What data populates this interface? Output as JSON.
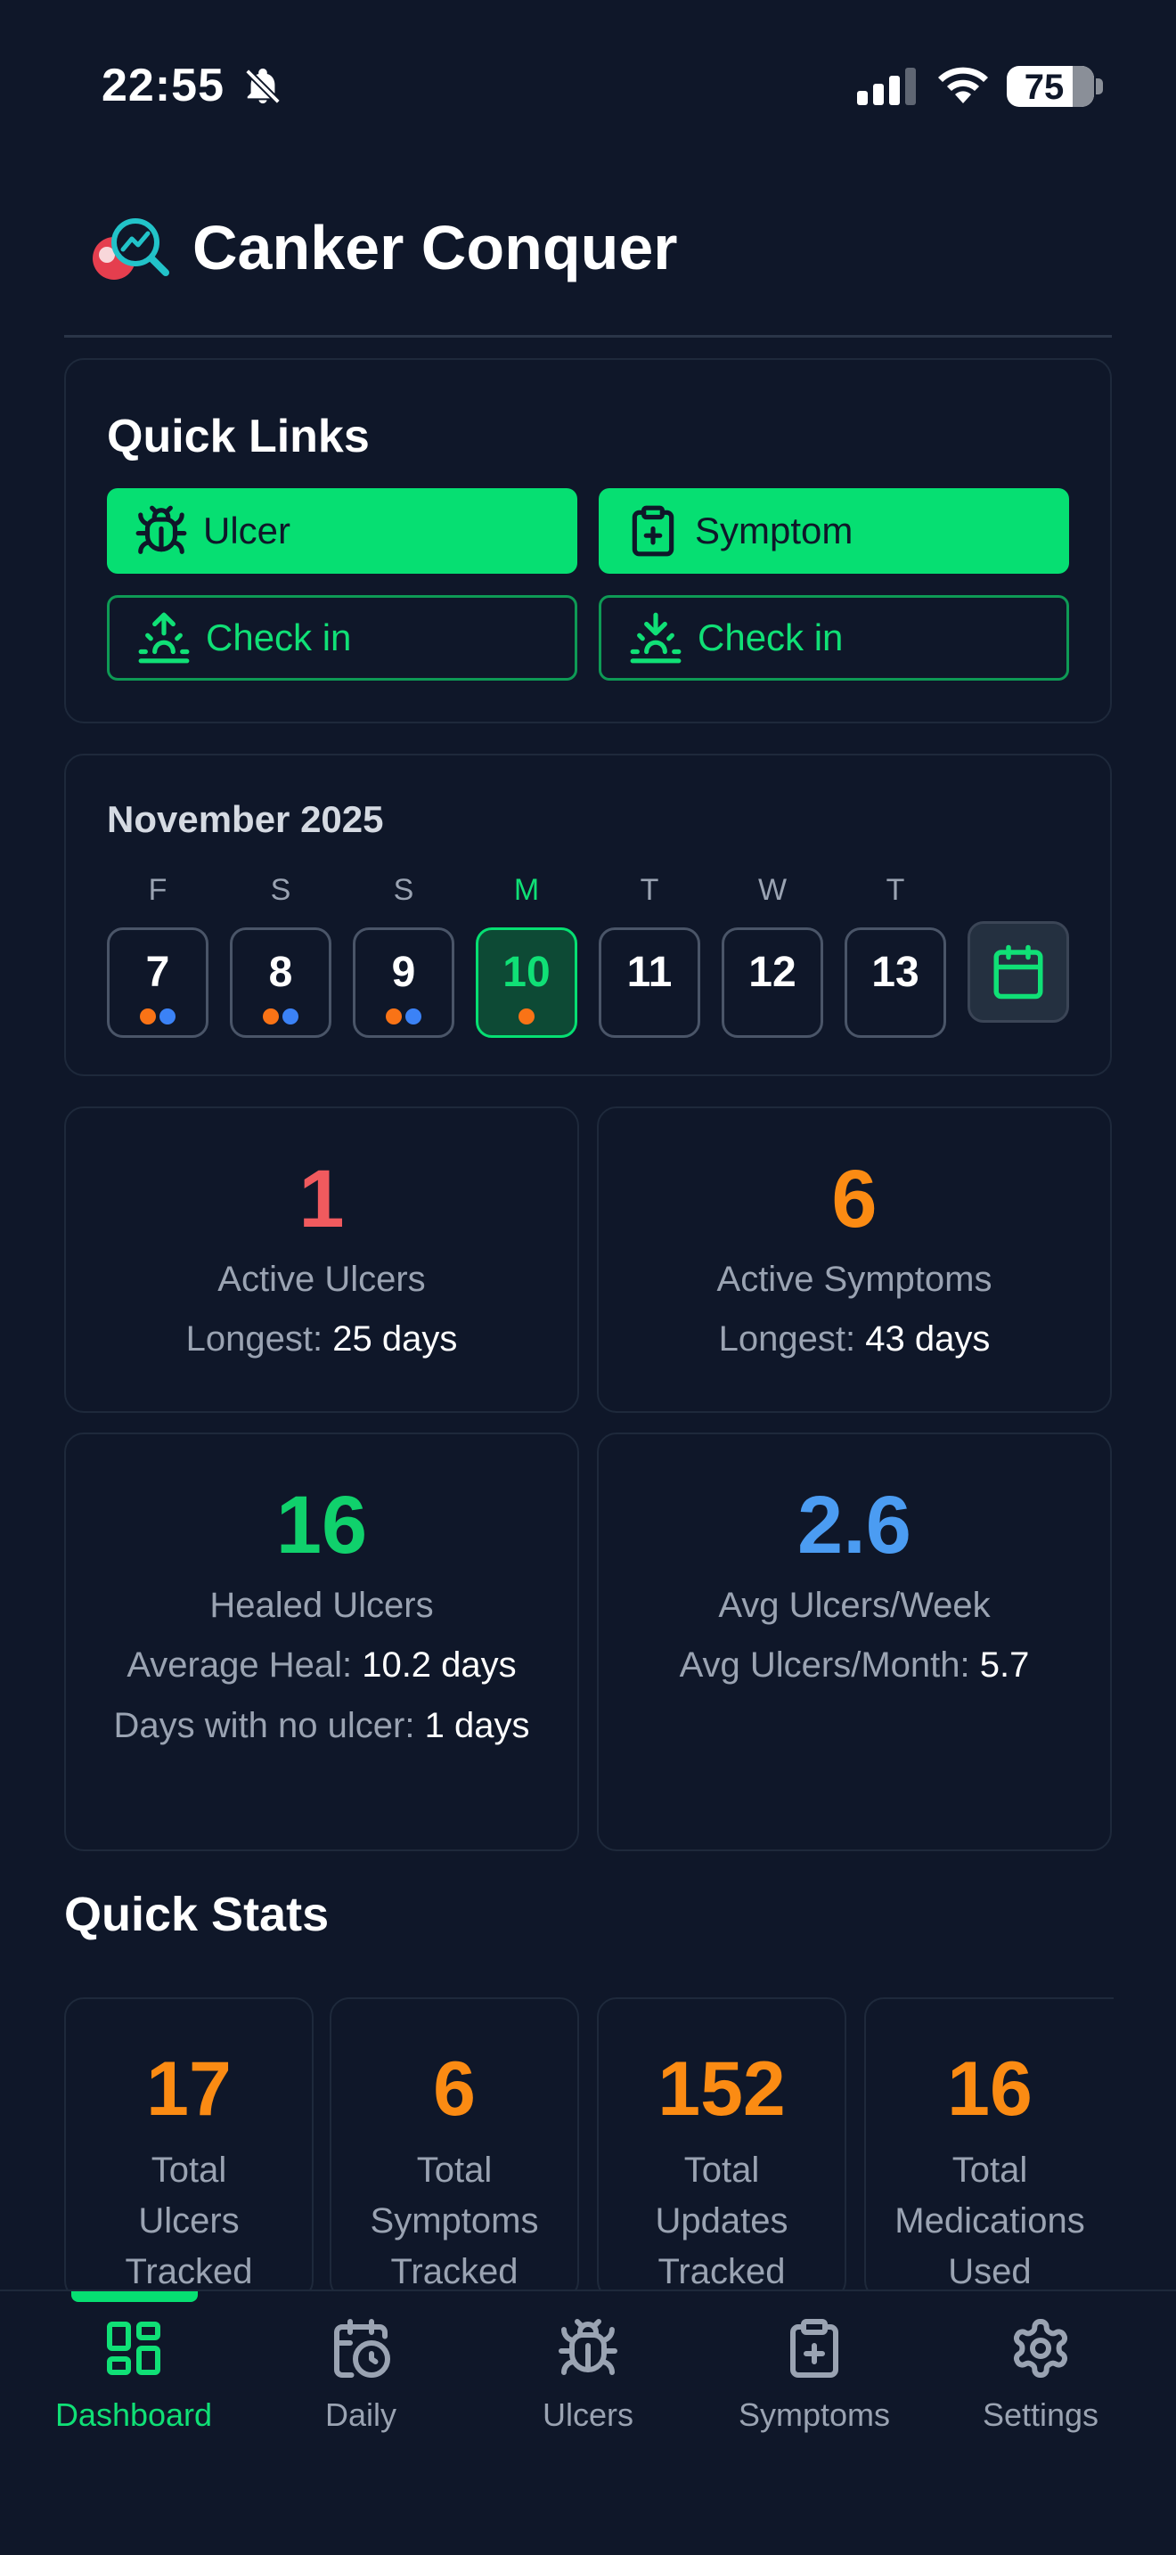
{
  "status_bar": {
    "time": "22:55",
    "battery": "75"
  },
  "header": {
    "title": "Canker Conquer"
  },
  "quick_links": {
    "title": "Quick Links",
    "buttons": [
      {
        "label": "Ulcer",
        "icon": "bug-icon",
        "style": "filled"
      },
      {
        "label": "Symptom",
        "icon": "clipboard-plus-icon",
        "style": "filled"
      },
      {
        "label": "Check in",
        "icon": "sunrise-icon",
        "style": "outline"
      },
      {
        "label": "Check in",
        "icon": "sunset-icon",
        "style": "outline"
      }
    ]
  },
  "calendar": {
    "month": "November 2025",
    "days": [
      {
        "letter": "F",
        "num": "7",
        "dots": [
          "#f97316",
          "#3b82f6"
        ]
      },
      {
        "letter": "S",
        "num": "8",
        "dots": [
          "#f97316",
          "#3b82f6"
        ]
      },
      {
        "letter": "S",
        "num": "9",
        "dots": [
          "#f97316",
          "#3b82f6"
        ]
      },
      {
        "letter": "M",
        "num": "10",
        "dots": [
          "#f97316"
        ],
        "today": true
      },
      {
        "letter": "T",
        "num": "11",
        "dots": []
      },
      {
        "letter": "W",
        "num": "12",
        "dots": []
      },
      {
        "letter": "T",
        "num": "13",
        "dots": []
      }
    ]
  },
  "stats": {
    "active_ulcers": {
      "value": "1",
      "label": "Active Ulcers",
      "longest_label": "Longest:",
      "longest_value": "25 days",
      "color": "#f05a5e"
    },
    "active_symptoms": {
      "value": "6",
      "label": "Active Symptoms",
      "longest_label": "Longest:",
      "longest_value": "43 days",
      "color": "#fb8b13"
    },
    "healed_ulcers": {
      "value": "16",
      "label": "Healed Ulcers",
      "avg_heal_label": "Average Heal:",
      "avg_heal_value": "10.2 days",
      "no_ulcer_label": "Days with no ulcer:",
      "no_ulcer_value": "1 days",
      "color": "#10d16c"
    },
    "avg_week": {
      "value": "2.6",
      "label": "Avg Ulcers/Week",
      "month_label": "Avg Ulcers/Month:",
      "month_value": "5.7",
      "color": "#4b9cf2"
    }
  },
  "quick_stats": {
    "title": "Quick Stats",
    "items": [
      {
        "value": "17",
        "label": "Total\nUlcers\nTracked"
      },
      {
        "value": "6",
        "label": "Total\nSymptoms\nTracked"
      },
      {
        "value": "152",
        "label": "Total\nUpdates\nTracked"
      },
      {
        "value": "16",
        "label": "Total\nMedications\nUsed"
      }
    ]
  },
  "nav": {
    "items": [
      {
        "label": "Dashboard",
        "icon": "dashboard-icon",
        "active": true
      },
      {
        "label": "Daily",
        "icon": "calendar-clock-icon"
      },
      {
        "label": "Ulcers",
        "icon": "bug-icon"
      },
      {
        "label": "Symptoms",
        "icon": "clipboard-plus-icon"
      },
      {
        "label": "Settings",
        "icon": "gear-icon"
      }
    ]
  },
  "colors": {
    "accent": "#06df72",
    "background": "#0f1729",
    "muted": "#9aa3b2"
  }
}
